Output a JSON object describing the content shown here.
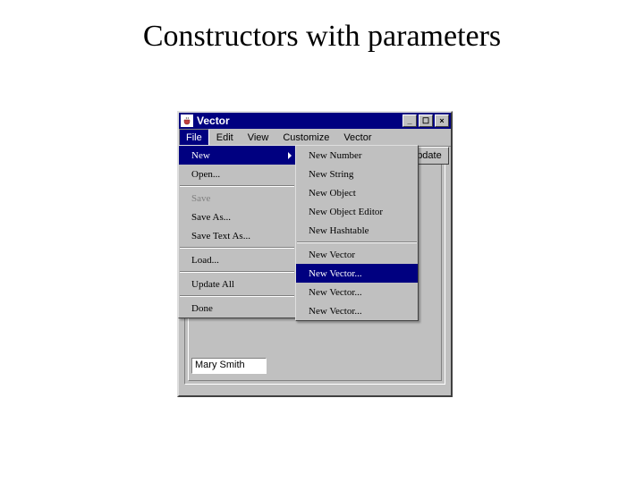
{
  "slide": {
    "title": "Constructors with parameters"
  },
  "window": {
    "title": "Vector",
    "controls": {
      "minimize": "_",
      "maximize": "☐",
      "close": "×"
    }
  },
  "menubar": {
    "items": [
      {
        "label": "File",
        "active": true
      },
      {
        "label": "Edit",
        "active": false
      },
      {
        "label": "View",
        "active": false
      },
      {
        "label": "Customize",
        "active": false
      },
      {
        "label": "Vector",
        "active": false
      }
    ]
  },
  "toolbar": {
    "update_label": "Update"
  },
  "fields": {
    "name_value": "Mary Smith"
  },
  "file_menu": {
    "items": [
      {
        "label": "New",
        "selected": true,
        "has_submenu": true
      },
      {
        "label": "Open...",
        "selected": false
      },
      {
        "label": "Save",
        "selected": false,
        "disabled": true
      },
      {
        "label": "Save As...",
        "selected": false
      },
      {
        "label": "Save Text As...",
        "selected": false
      },
      {
        "label": "Load...",
        "selected": false
      },
      {
        "label": "Update All",
        "selected": false
      },
      {
        "label": "Done",
        "selected": false
      }
    ]
  },
  "new_submenu": {
    "items": [
      {
        "label": "New Number",
        "selected": false
      },
      {
        "label": "New String",
        "selected": false
      },
      {
        "label": "New Object",
        "selected": false
      },
      {
        "label": "New Object Editor",
        "selected": false
      },
      {
        "label": "New Hashtable",
        "selected": false
      },
      {
        "label": "New Vector",
        "selected": false
      },
      {
        "label": "New Vector...",
        "selected": true
      },
      {
        "label": "New Vector...",
        "selected": false
      },
      {
        "label": "New Vector...",
        "selected": false
      }
    ]
  }
}
